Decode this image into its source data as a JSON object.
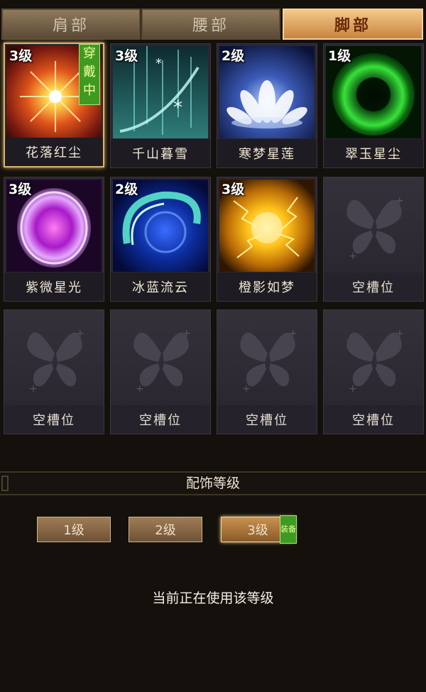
{
  "tabs": [
    {
      "label": "肩部",
      "active": false
    },
    {
      "label": "腰部",
      "active": false
    },
    {
      "label": "脚部",
      "active": true
    }
  ],
  "slots": [
    {
      "level": "3级",
      "name": "花落红尘",
      "icon": "red-burst-icon",
      "wearing": "穿戴中",
      "selected": true
    },
    {
      "level": "3级",
      "name": "千山暮雪",
      "icon": "snowfall-icon"
    },
    {
      "level": "2级",
      "name": "寒梦星莲",
      "icon": "lotus-icon"
    },
    {
      "level": "1级",
      "name": "翠玉星尘",
      "icon": "green-ring-icon"
    },
    {
      "level": "3级",
      "name": "紫微星光",
      "icon": "purple-orb-icon"
    },
    {
      "level": "2级",
      "name": "冰蓝流云",
      "icon": "blue-swirl-icon"
    },
    {
      "level": "3级",
      "name": "橙影如梦",
      "icon": "gold-storm-icon"
    },
    {
      "level": "",
      "name": "空槽位",
      "icon": "butterfly-icon",
      "empty": true
    },
    {
      "level": "",
      "name": "空槽位",
      "icon": "butterfly-icon",
      "empty": true
    },
    {
      "level": "",
      "name": "空槽位",
      "icon": "butterfly-icon",
      "empty": true
    },
    {
      "level": "",
      "name": "空槽位",
      "icon": "butterfly-icon",
      "empty": true
    },
    {
      "level": "",
      "name": "空槽位",
      "icon": "butterfly-icon",
      "empty": true
    }
  ],
  "section": {
    "title": "配饰等级",
    "levels": [
      {
        "label": "1级",
        "active": false
      },
      {
        "label": "2级",
        "active": false
      },
      {
        "label": "3级",
        "active": true,
        "tag": "装备"
      }
    ],
    "status": "当前正在使用该等级"
  },
  "colors": {
    "background": "#14100c",
    "tab_active": "#e0a45e",
    "equip_green": "#3f9a23"
  }
}
